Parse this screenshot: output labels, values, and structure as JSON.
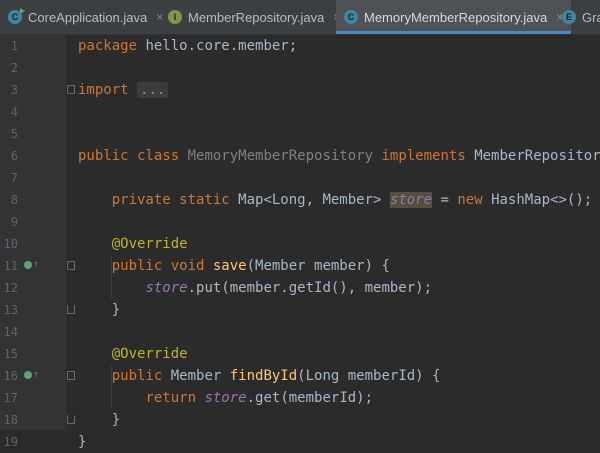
{
  "tabs": [
    {
      "label": "CoreApplication.java",
      "icon": "class-runnable-icon",
      "active": false
    },
    {
      "label": "MemberRepository.java",
      "icon": "interface-icon",
      "active": false
    },
    {
      "label": "MemoryMemberRepository.java",
      "icon": "class-icon",
      "active": true
    },
    {
      "label": "Gra",
      "icon": "enum-icon",
      "active": false
    }
  ],
  "tab_close_glyph": "×",
  "icon_letters": {
    "class": "C",
    "interface": "I",
    "enum": "E"
  },
  "line_numbers": [
    "1",
    "2",
    "3",
    "4",
    "5",
    "6",
    "7",
    "8",
    "9",
    "10",
    "11",
    "12",
    "13",
    "14",
    "15",
    "16",
    "17",
    "18",
    "19"
  ],
  "code": {
    "l1_kw": "package",
    "l1_rest": " hello.core.member;",
    "l3_kw": "import",
    "l3_fold": "...",
    "l6_kw": "public class",
    "l6_name": "MemoryMemberRepository",
    "l6_kw2": "implements",
    "l6_rest": " MemberRepository{",
    "l8_kw": "private static",
    "l8_type": " Map<Long, Member> ",
    "l8_field": "store",
    "l8_eq": " = ",
    "l8_new": "new",
    "l8_rest": " HashMap<>();",
    "l10_ann": "@Override",
    "l11_kw": "public void",
    "l11_method": "save",
    "l11_rest": "(Member member) {",
    "l12_field": "store",
    "l12_rest": ".put(member.getId(), member);",
    "l13": "}",
    "l15_ann": "@Override",
    "l16_kw": "public",
    "l16_type": " Member ",
    "l16_method": "findById",
    "l16_rest": "(Long memberId) {",
    "l17_kw": "return",
    "l17_field": "store",
    "l17_rest": ".get(memberId);",
    "l18": "}",
    "l19": "}"
  },
  "colors": {
    "background": "#2b2b2b",
    "keyword": "#cc7832",
    "annotation": "#bbb529",
    "field": "#9876aa",
    "method": "#ffc66d",
    "text": "#a9b7c6",
    "active_tab_underline": "#4a88c7"
  }
}
